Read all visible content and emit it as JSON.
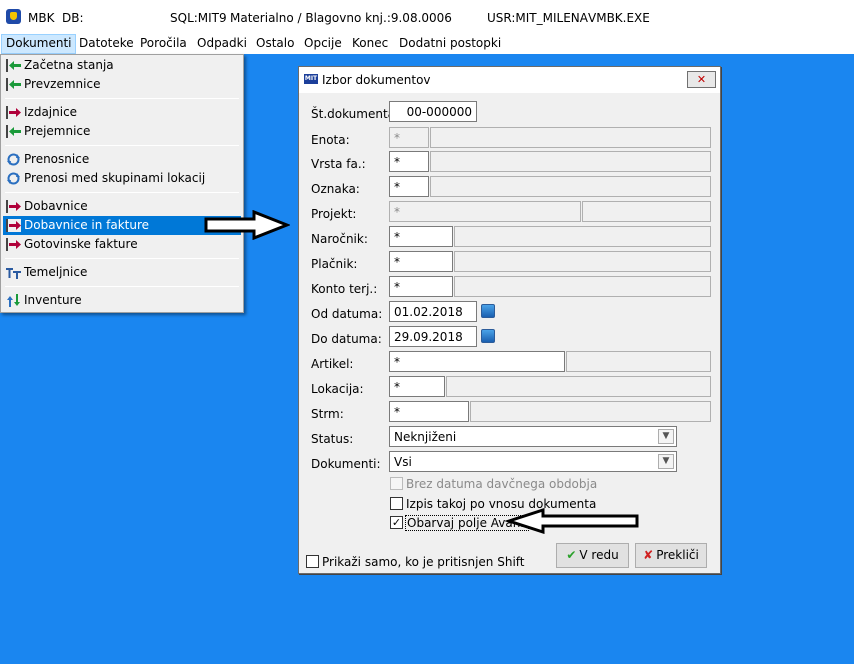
{
  "app": {
    "name": "MBK",
    "db_label": "DB:",
    "sql_info": "SQL:MIT9",
    "subtitle": "Materialno / Blagovno knj.:9.08.0006",
    "user": "USR:MIT_MILENA",
    "exe": "VMBK.EXE"
  },
  "menubar": [
    "Dokumenti",
    "Datoteke",
    "Poročila",
    "Odpadki",
    "Ostalo",
    "Opcije",
    "Konec",
    "Dodatni postopki"
  ],
  "dropdown": [
    {
      "label": "Začetna stanja",
      "icon": "arrow-in-green-icon"
    },
    {
      "label": "Prevzemnice",
      "icon": "arrow-in-green-icon"
    },
    {
      "label": "Izdajnice",
      "icon": "arrow-out-red-icon"
    },
    {
      "label": "Prejemnice",
      "icon": "arrow-in-green-icon"
    },
    {
      "label": "Prenosnice",
      "icon": "transfer-icon"
    },
    {
      "label": "Prenosi med skupinami lokacij",
      "icon": "transfer-icon"
    },
    {
      "label": "Dobavnice",
      "icon": "arrow-out-red-icon"
    },
    {
      "label": "Dobavnice in fakture",
      "icon": "arrow-out-red-icon",
      "selected": true
    },
    {
      "label": "Gotovinske fakture",
      "icon": "arrow-out-red-icon"
    },
    {
      "label": "Temeljnice",
      "icon": "ledger-icon"
    },
    {
      "label": "Inventure",
      "icon": "inventory-icon"
    }
  ],
  "dialog": {
    "title": "Izbor dokumentov",
    "close": "✕",
    "fields": {
      "st_dokumenta": {
        "label": "Št.dokumenta:",
        "value": "00-000000"
      },
      "enota": {
        "label": "Enota:",
        "value": "*"
      },
      "vrsta_fa": {
        "label": "Vrsta fa.:",
        "value": "*"
      },
      "oznaka": {
        "label": "Oznaka:",
        "value": "*"
      },
      "projekt": {
        "label": "Projekt:",
        "value": "*"
      },
      "narocnik": {
        "label": "Naročnik:",
        "value": "*"
      },
      "placnik": {
        "label": "Plačnik:",
        "value": "*"
      },
      "konto": {
        "label": "Konto terj.:",
        "value": "*"
      },
      "od_datuma": {
        "label": "Od datuma:",
        "value": "01.02.2018"
      },
      "do_datuma": {
        "label": "Do datuma:",
        "value": "29.09.2018"
      },
      "artikel": {
        "label": "Artikel:",
        "value": "*"
      },
      "lokacija": {
        "label": "Lokacija:",
        "value": "*"
      },
      "strm": {
        "label": "Strm:",
        "value": "*"
      },
      "status": {
        "label": "Status:",
        "value": "Neknjiženi"
      },
      "dokumenti": {
        "label": "Dokumenti:",
        "value": "Vsi"
      }
    },
    "checks": {
      "brez_datuma": {
        "label": "Brez datuma davčnega obdobja",
        "checked": false,
        "disabled": true
      },
      "izpis": {
        "label": "Izpis takoj po vnosu dokumenta",
        "checked": false
      },
      "avans": {
        "label": "Obarvaj polje Avans",
        "checked": true
      },
      "shift": {
        "label": "Prikaži samo, ko je pritisnjen Shift",
        "checked": false
      }
    },
    "buttons": {
      "ok": "V redu",
      "cancel": "Prekliči"
    }
  },
  "colors": {
    "desktop": "#1a86f0",
    "selection": "#0078d7"
  }
}
